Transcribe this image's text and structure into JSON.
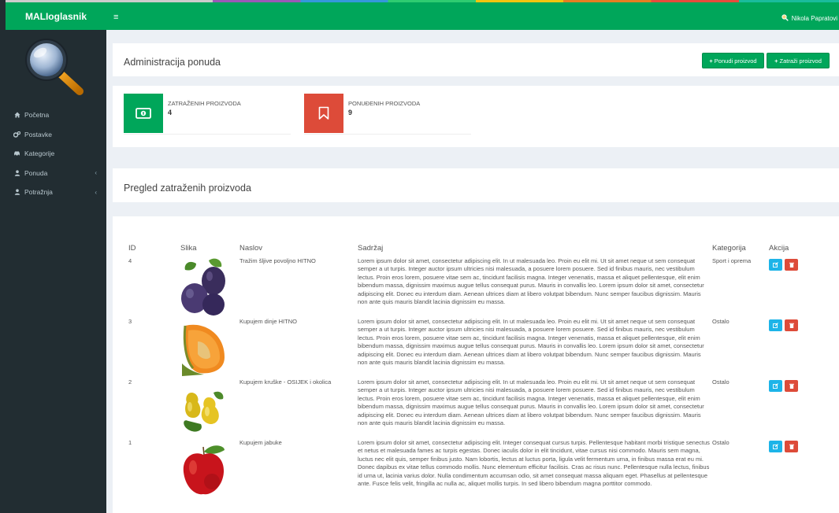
{
  "brand": "MALIoglasnik",
  "topbar": {
    "menu_icon": "hamburger-icon",
    "user_name": "Nikola Papratovi"
  },
  "sidebar": {
    "items": [
      {
        "label": "Početna",
        "icon": "home-icon",
        "has_children": false
      },
      {
        "label": "Postavke",
        "icon": "gears-icon",
        "has_children": false
      },
      {
        "label": "Kategorije",
        "icon": "car-icon",
        "has_children": false
      },
      {
        "label": "Ponuda",
        "icon": "user-icon",
        "has_children": true
      },
      {
        "label": "Potražnja",
        "icon": "user-icon",
        "has_children": true
      }
    ]
  },
  "admin": {
    "title": "Administracija ponuda",
    "offer_button": "Ponudi proizvod",
    "request_button": "Zatraži proizvod"
  },
  "stats": [
    {
      "label": "ZATRAŽENIH PROIZVODA",
      "value": "4",
      "color": "#00a65a",
      "icon": "money-icon"
    },
    {
      "label": "PONUĐENIH PROIZVODA",
      "value": "9",
      "color": "#dd4b39",
      "icon": "bookmark-icon"
    }
  ],
  "overview": {
    "title": "Pregled zatraženih proizvoda"
  },
  "table": {
    "headers": {
      "id": "ID",
      "image": "Slika",
      "title": "Naslov",
      "content": "Sadržaj",
      "category": "Kategorija",
      "action": "Akcija"
    },
    "rows": [
      {
        "id": "4",
        "image": "plums-image",
        "title": "Tražim šljive povoljno HITNO",
        "category": "Sport i oprema",
        "content": "Lorem ipsum dolor sit amet, consectetur adipiscing elit. In ut malesuada leo. Proin eu elit mi. Ut sit amet neque ut sem consequat semper a ut turpis. Integer auctor ipsum ultricies nisi malesuada, a posuere lorem posuere. Sed id finibus mauris, nec vestibulum lectus. Proin eros lorem, posuere vitae sem ac, tincidunt facilisis magna. Integer venenatis, massa et aliquet pellentesque, elit enim bibendum massa, dignissim maximus augue tellus consequat purus. Mauris in convallis leo. Lorem ipsum dolor sit amet, consectetur adipiscing elit. Donec eu interdum diam. Aenean ultrices diam at libero volutpat bibendum. Nunc semper faucibus dignissim. Mauris non ante quis mauris blandit lacinia dignissim eu massa."
      },
      {
        "id": "3",
        "image": "melon-image",
        "title": "Kupujem dinje HITNO",
        "category": "Ostalo",
        "content": "Lorem ipsum dolor sit amet, consectetur adipiscing elit. In ut malesuada leo. Proin eu elit mi. Ut sit amet neque ut sem consequat semper a ut turpis. Integer auctor ipsum ultricies nisi malesuada, a posuere lorem posuere. Sed id finibus mauris, nec vestibulum lectus. Proin eros lorem, posuere vitae sem ac, tincidunt facilisis magna. Integer venenatis, massa et aliquet pellentesque, elit enim bibendum massa, dignissim maximus augue tellus consequat purus. Mauris in convallis leo. Lorem ipsum dolor sit amet, consectetur adipiscing elit. Donec eu interdum diam. Aenean ultrices diam at libero volutpat bibendum. Nunc semper faucibus dignissim. Mauris non ante quis mauris blandit lacinia dignissim eu massa."
      },
      {
        "id": "2",
        "image": "pears-image",
        "title": "Kupujem kruške - OSIJEK i okolica",
        "category": "Ostalo",
        "content": "Lorem ipsum dolor sit amet, consectetur adipiscing elit. In ut malesuada leo. Proin eu elit mi. Ut sit amet neque ut sem consequat semper a ut turpis. Integer auctor ipsum ultricies nisi malesuada, a posuere lorem posuere. Sed id finibus mauris, nec vestibulum lectus. Proin eros lorem, posuere vitae sem ac, tincidunt facilisis magna. Integer venenatis, massa et aliquet pellentesque, elit enim bibendum massa, dignissim maximus augue tellus consequat purus. Mauris in convallis leo. Lorem ipsum dolor sit amet, consectetur adipiscing elit. Donec eu interdum diam. Aenean ultrices diam at libero volutpat bibendum. Nunc semper faucibus dignissim. Mauris non ante quis mauris blandit lacinia dignissim eu massa."
      },
      {
        "id": "1",
        "image": "apple-image",
        "title": "Kupujem jabuke",
        "category": "Ostalo",
        "content": "Lorem ipsum dolor sit amet, consectetur adipiscing elit. Integer consequat cursus turpis. Pellentesque habitant morbi tristique senectus et netus et malesuada fames ac turpis egestas. Donec iaculis dolor in elit tincidunt, vitae cursus nisi commodo. Mauris sem magna, luctus nec elit quis, semper finibus justo. Nam lobortis, lectus at luctus porta, ligula velit fermentum urna, in finibus massa erat eu mi. Donec dapibus ex vitae tellus commodo mollis. Nunc elementum efficitur facilisis. Cras ac risus nunc. Pellentesque nulla lectus, finibus id urna ut, lacinia varius dolor. Nulla condimentum accumsan odio, sit amet consequat massa aliquam eget. Phasellus at pellentesque ante. Fusce felis velit, fringilla ac nulla ac, aliquet mollis turpis. In sed libero bibendum magna porttitor commodo."
      }
    ]
  }
}
